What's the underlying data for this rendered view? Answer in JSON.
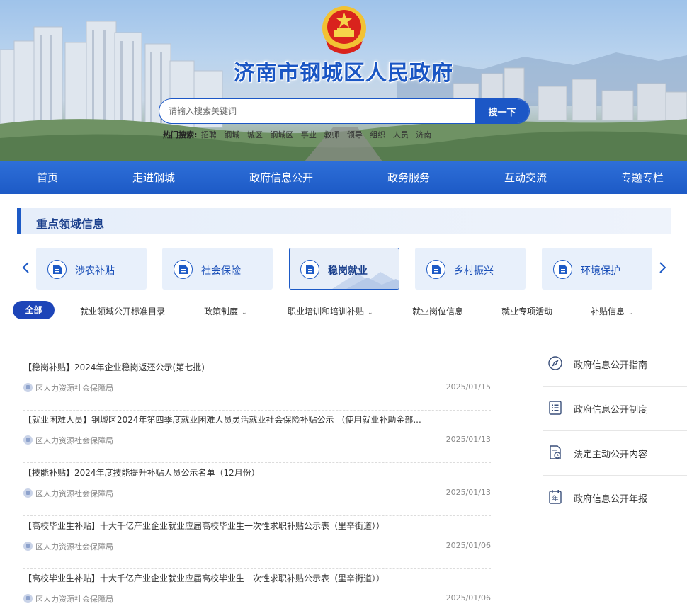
{
  "header": {
    "site_title": "济南市钢城区人民政府",
    "search_placeholder": "请输入搜索关键词",
    "search_button": "搜一下",
    "hot_label": "热门搜索:",
    "hot_words": [
      "招聘",
      "钢城",
      "城区",
      "钢城区",
      "事业",
      "教师",
      "领导",
      "组织",
      "人员",
      "济南"
    ]
  },
  "nav": [
    "首页",
    "走进钢城",
    "政府信息公开",
    "政务服务",
    "互动交流",
    "专题专栏"
  ],
  "section": {
    "title": "重点领域信息"
  },
  "categories": [
    {
      "label": "涉农补贴",
      "active": false
    },
    {
      "label": "社会保险",
      "active": false
    },
    {
      "label": "稳岗就业",
      "active": true
    },
    {
      "label": "乡村振兴",
      "active": false
    },
    {
      "label": "环境保护",
      "active": false
    }
  ],
  "filters": {
    "all": "全部",
    "items": [
      {
        "label": "就业领域公开标准目录",
        "dropdown": false
      },
      {
        "label": "政策制度",
        "dropdown": true
      },
      {
        "label": "职业培训和培训补贴",
        "dropdown": true
      },
      {
        "label": "就业岗位信息",
        "dropdown": false
      },
      {
        "label": "就业专项活动",
        "dropdown": false
      },
      {
        "label": "补贴信息",
        "dropdown": true
      }
    ]
  },
  "news": [
    {
      "title": "【稳岗补贴】2024年企业稳岗返还公示(第七批)",
      "source": "区人力资源社会保障局",
      "date": "2025/01/15"
    },
    {
      "title": "【就业困难人员】钢城区2024年第四季度就业困难人员灵活就业社会保险补贴公示 （使用就业补助金部...",
      "source": "区人力资源社会保障局",
      "date": "2025/01/13"
    },
    {
      "title": "【技能补贴】2024年度技能提升补贴人员公示名单（12月份）",
      "source": "区人力资源社会保障局",
      "date": "2025/01/13"
    },
    {
      "title": "【高校毕业生补贴】十大千亿产业企业就业应届高校毕业生一次性求职补贴公示表（里辛街道））",
      "source": "区人力资源社会保障局",
      "date": "2025/01/06"
    },
    {
      "title": "【高校毕业生补贴】十大千亿产业企业就业应届高校毕业生一次性求职补贴公示表（里辛街道））",
      "source": "区人力资源社会保障局",
      "date": "2025/01/06"
    }
  ],
  "side_links": [
    {
      "label": "政府信息公开指南",
      "icon": "compass-icon"
    },
    {
      "label": "政府信息公开制度",
      "icon": "list-icon"
    },
    {
      "label": "法定主动公开内容",
      "icon": "document-clock-icon"
    },
    {
      "label": "政府信息公开年报",
      "icon": "calendar-year-icon"
    }
  ],
  "side_icon_text": "年",
  "colors": {
    "primary": "#1d5ac6",
    "nav_bg": "#2668d3",
    "title": "#1a56c4",
    "card_bg": "#e8f0fb",
    "all_btn": "#1d45b8"
  }
}
